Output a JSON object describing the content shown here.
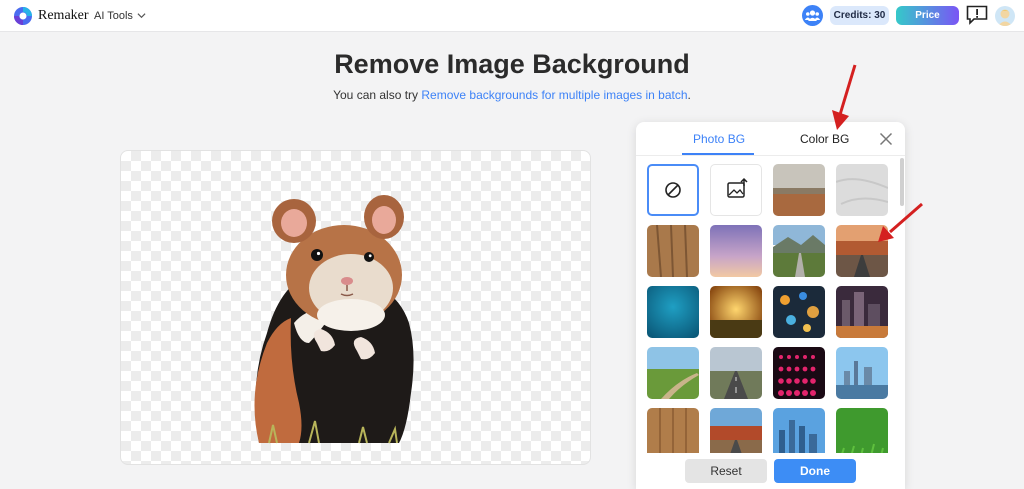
{
  "header": {
    "brand": "Remaker",
    "ai_tools_label": "AI Tools",
    "credits": "Credits: 30",
    "price_label": "Price",
    "icons": [
      "remaker-logo-icon",
      "chevron-down-icon",
      "community-icon",
      "feedback-icon",
      "user-avatar"
    ]
  },
  "main": {
    "title": "Remove Image Background",
    "subtitle_prefix": "You can also try ",
    "subtitle_link": "Remove backgrounds for multiple images in batch",
    "subtitle_suffix": "."
  },
  "panel": {
    "tabs": [
      {
        "label": "Photo BG",
        "active": true
      },
      {
        "label": "Color BG",
        "active": false
      }
    ],
    "reset_label": "Reset",
    "done_label": "Done",
    "tiles": [
      "none",
      "upload",
      "desert",
      "marble",
      "wood-leaf",
      "purple-sky",
      "mountain-road",
      "canyon-road",
      "teal",
      "sunset-field",
      "bokeh",
      "city-night",
      "countryside-road",
      "highway",
      "pink-lights",
      "skyline-blue",
      "wood-planks",
      "red-rock-road",
      "city-day",
      "green-grass"
    ]
  },
  "colors": {
    "accent": "#3d82f7",
    "price_gradient_start": "#35c9c9",
    "price_gradient_end": "#7a55f5",
    "arrow": "#d42020"
  }
}
